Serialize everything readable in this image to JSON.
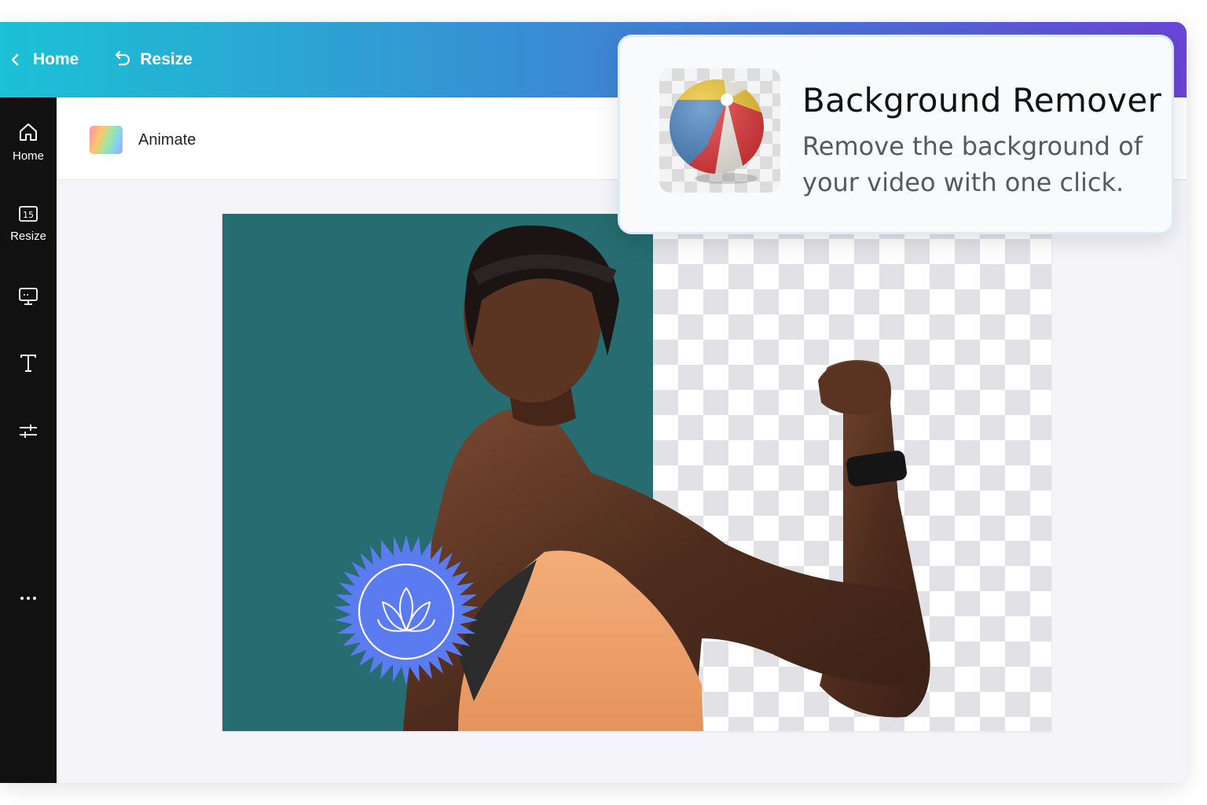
{
  "header": {
    "back_label": "Home",
    "resize_label": "Resize"
  },
  "sidebar": {
    "items": [
      {
        "label": "Home",
        "icon": "home-icon"
      },
      {
        "label": "Resize",
        "icon": "resize-icon"
      },
      {
        "label": "",
        "icon": "present-icon"
      },
      {
        "label": "",
        "icon": "text-icon"
      },
      {
        "label": "",
        "icon": "adjust-icon"
      },
      {
        "label": "",
        "icon": "more-icon"
      }
    ]
  },
  "toolbar": {
    "animate_label": "Animate"
  },
  "popup": {
    "title": "Background Remover",
    "description": "Remove the background of your video with one click."
  },
  "colors": {
    "topbar_start": "#1bc1d6",
    "topbar_end": "#6a45d8",
    "sidebar": "#111111",
    "canvas_teal": "#266c70",
    "badge_blue": "#5a7cf0",
    "shirt_orange": "#f2a56e"
  }
}
